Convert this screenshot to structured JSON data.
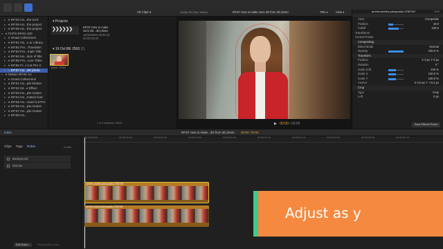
{
  "toolbar": {
    "left_buttons": [
      "libraries-button",
      "photos-button",
      "titles-button"
    ],
    "right_buttons": [
      "timeline-index",
      "video-scopes",
      "inspector"
    ]
  },
  "libraries": {
    "items": [
      {
        "label": "EP.04 Ho...the ecrit",
        "indent": 1,
        "selected": false
      },
      {
        "label": "EP.05 Ho...the project",
        "indent": 1,
        "selected": false
      },
      {
        "label": "EP.06 Ho...the project",
        "indent": 1,
        "selected": false
      },
      {
        "label": "FCPX EP.81-100",
        "indent": 0,
        "selected": false
      },
      {
        "label": "Smart Collections",
        "indent": 1,
        "selected": false
      },
      {
        "label": "EP.81 Ho...o ur Library",
        "indent": 1,
        "selected": false
      },
      {
        "label": "EP.82 Fre...Transition",
        "indent": 1,
        "selected": false
      },
      {
        "label": "EP.83 Fre...mple Title",
        "indent": 1,
        "selected": false
      },
      {
        "label": "EP.84 Ho...ition of title",
        "indent": 1,
        "selected": false
      },
      {
        "label": "EP.85 Fre...Line Titles",
        "indent": 1,
        "selected": false
      },
      {
        "label": "EP.86 Fr...l Cut Pro X",
        "indent": 1,
        "selected": false
      },
      {
        "label": "EP.87 Ho...3D photo",
        "indent": 1,
        "selected": true
      },
      {
        "label": "Motion EP.01-10",
        "indent": 0,
        "selected": false
      },
      {
        "label": "Smart Collections",
        "indent": 1,
        "selected": false
      },
      {
        "label": "EP.01 Ho...ple Motion",
        "indent": 1,
        "selected": false
      },
      {
        "label": "EP.02 Int...e Effect",
        "indent": 1,
        "selected": false
      },
      {
        "label": "EP.03 Ho...ple motion",
        "indent": 1,
        "selected": false
      },
      {
        "label": "EP.04 Ho...mated river",
        "indent": 1,
        "selected": false
      },
      {
        "label": "EP.05 Ho...ctual Cut Pro",
        "indent": 1,
        "selected": false
      },
      {
        "label": "EP.06 Ho...ple motion",
        "indent": 1,
        "selected": false
      },
      {
        "label": "EP.07 Ho...ple motion",
        "indent": 1,
        "selected": false
      },
      {
        "label": "EP.08 Ho...",
        "indent": 1,
        "selected": false
      }
    ]
  },
  "clips": {
    "filter": "All Clips",
    "projects_label": "Projects",
    "project": {
      "name_line1": "EP.87 How to make",
      "name_line2": "semi 3D...3D photo",
      "date": "19/10/2563 05:00:23",
      "duration": "00:00:03:00"
    },
    "event_date": "19 Oct BE 2563",
    "event_count": "(1)",
    "clip_name": "pexel...5783",
    "selection_status": "1 of 3 selected, 03:00"
  },
  "viewer": {
    "resolution": "1920p HD 25p, Stereo",
    "title": "EP.87 How to make semi 3D from 2D photo",
    "zoom": "78%",
    "view_menu": "View",
    "timecode_current": "00:00",
    "timecode_total": "03:00"
  },
  "inspector": {
    "clip_title": "pexels-andrea-piacquadio-3782762",
    "duration": "3:00",
    "rows": [
      {
        "label": "View",
        "value": "Composite",
        "type": "menu"
      },
      {
        "label": "Position",
        "value": "16.0",
        "type": "slider",
        "fill": 0.3
      },
      {
        "label": "Falloff",
        "value": "100.0",
        "type": "slider",
        "fill": 0.7
      },
      {
        "label": "Transforms",
        "value": "",
        "type": "disclosure"
      },
      {
        "label": "Control Points",
        "value": "",
        "type": "disclosure"
      },
      {
        "label": "Compositing",
        "value": "",
        "type": "header"
      },
      {
        "label": "Blend Mode",
        "value": "Normal",
        "type": "menu"
      },
      {
        "label": "Opacity",
        "value": "100.0 %",
        "type": "slider",
        "fill": 1.0
      },
      {
        "label": "Transform",
        "value": "",
        "type": "header"
      },
      {
        "label": "Position",
        "value": "X 0 px   Y 0 px",
        "type": "text"
      },
      {
        "label": "Rotation",
        "value": "0 °",
        "type": "text"
      },
      {
        "label": "Scale (All)",
        "value": "100 %",
        "type": "slider",
        "fill": 0.5
      },
      {
        "label": "Scale X",
        "value": "100.0 %",
        "type": "slider",
        "fill": 0.5
      },
      {
        "label": "Scale Y",
        "value": "100.0 %",
        "type": "slider",
        "fill": 0.5
      },
      {
        "label": "Anchor",
        "value": "X 0.0 px   Y -73.4 px",
        "type": "text"
      },
      {
        "label": "Crop",
        "value": "",
        "type": "header"
      },
      {
        "label": "Type",
        "value": "Crop",
        "type": "menu"
      },
      {
        "label": "Left",
        "value": "0 px",
        "type": "text"
      }
    ],
    "save_preset": "Save Effects Preset"
  },
  "timeline": {
    "index_label": "Index",
    "project_title": "EP.87 How to make...3D from 2D photo",
    "timecode": "00:00 / 03:00",
    "index_tabs": [
      "Clips",
      "Tags",
      "Roles"
    ],
    "active_tab": "Roles",
    "roles_count": "3 roles",
    "roles": [
      "Background",
      "Woman"
    ],
    "ruler": [
      "00:00:00:00",
      "00:00:00:10",
      "00:00:00:15",
      "00:00:01:00",
      "00:00:01:05",
      "00:00:01:10",
      "00:00:01:15",
      "00:00:02:00",
      "00:00:02:05",
      "00:00:02:10"
    ],
    "upper_clip_name": "pexels-andrea-piacquadio-3782762",
    "lower_clip_name": "pexels-andrea-piacquadio-3782762",
    "edit_roles_button": "Edit Roles...",
    "show_audio_button": "Show Audio Lanes"
  },
  "caption": {
    "text": "Adjust as y",
    "bg_color": "#f5893f",
    "accent_color": "#3fc98a"
  },
  "colors": {
    "selection": "#3d5ea8",
    "clip_orange": "#a86a1c",
    "playhead": "#e8e8e8"
  }
}
